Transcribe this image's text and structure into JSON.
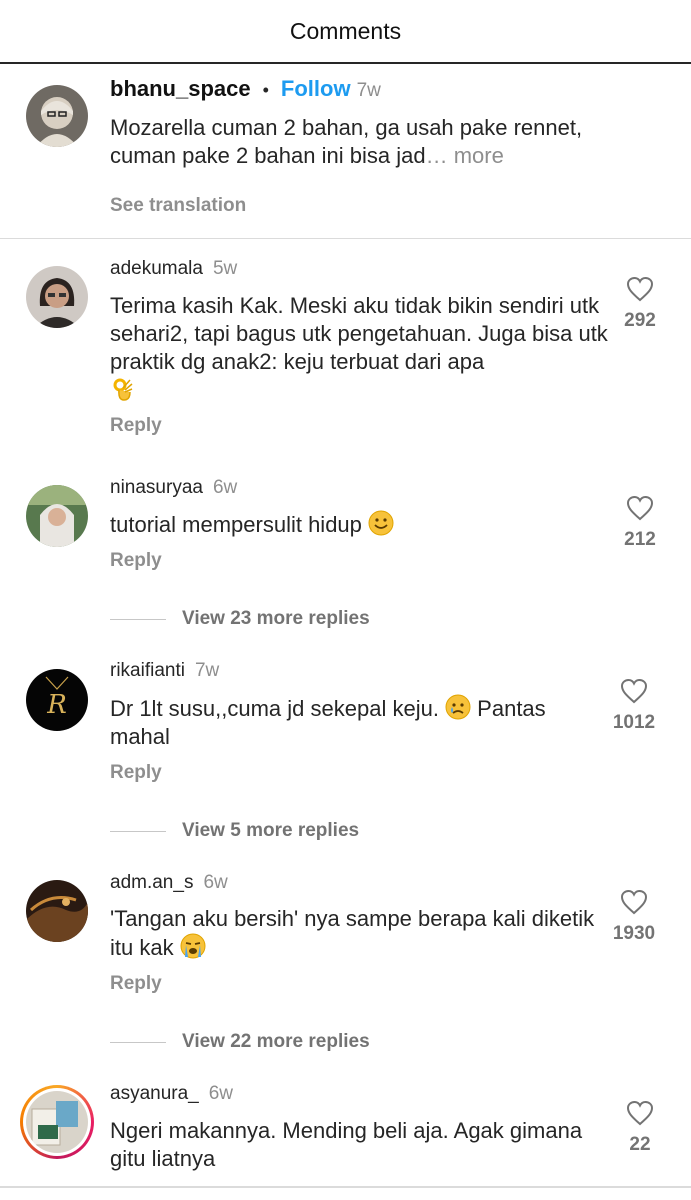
{
  "header": {
    "title": "Comments"
  },
  "op": {
    "username": "bhanu_space",
    "dot": "•",
    "follow": "Follow",
    "time": "7w",
    "text": "Mozarella cuman 2 bahan, ga usah pake rennet, cuman pake 2 bahan ini bisa jad",
    "ellipsis": "… ",
    "more": "more",
    "see_translation": "See translation"
  },
  "comments": [
    {
      "username": "adekumala",
      "time": "5w",
      "text": "Terima kasih Kak. Meski aku tidak bikin sendiri utk sehari2, tapi bagus utk pengetahuan. Juga bisa utk praktik dg anak2: keju terbuat dari apa",
      "emoji": "ok-hand-emoji",
      "reply": "Reply",
      "likes": "292"
    },
    {
      "username": "ninasuryaa",
      "time": "6w",
      "text": "tutorial mempersulit hidup",
      "emoji": "smiling-emoji",
      "reply": "Reply",
      "likes": "212",
      "view_replies": "View 23 more replies"
    },
    {
      "username": "rikaifianti",
      "time": "7w",
      "text": "Dr 1lt susu,,cuma jd sekepal keju.",
      "text2": " Pantas mahal",
      "emoji": "crying-emoji",
      "reply": "Reply",
      "likes": "1012",
      "view_replies": "View 5 more replies"
    },
    {
      "username": "adm.an_s",
      "time": "6w",
      "text": "'Tangan aku bersih' nya sampe berapa kali diketik itu kak",
      "emoji": "loudly-crying-emoji",
      "reply": "Reply",
      "likes": "1930",
      "view_replies": "View 22 more replies"
    },
    {
      "username": "asyanura_",
      "time": "6w",
      "text": "Ngeri makannya. Mending beli aja. Agak gimana gitu liatnya",
      "likes": "22"
    }
  ]
}
